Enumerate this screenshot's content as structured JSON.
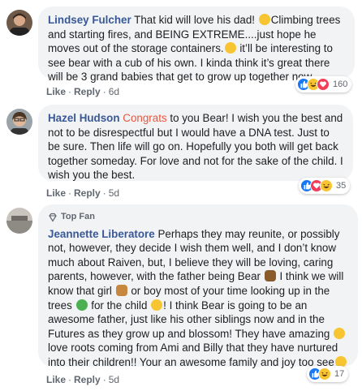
{
  "comments": [
    {
      "author": "Lindsey Fulcher",
      "text_parts": [
        " That kid will love his dad! ",
        "Climbing trees and starting fires, and BEING EXTREME....just hope he moves out of the storage containers.",
        " it’ll be interesting to see bear with a cub of his own. I kinda think it’s great there will be 3 grand babies that get to grow up together now."
      ],
      "actions": {
        "like": "Like",
        "reply": "Reply",
        "time": "6d"
      },
      "reaction_count": "160",
      "reaction_icons": [
        "like-icon",
        "haha-icon",
        "love-icon"
      ]
    },
    {
      "author": "Hazel Hudson",
      "highlight": "Congrats",
      "text": " to you Bear! I wish you the best and not to be disrespectful but I would have a DNA test. Just to be sure. Then life will go on. Hopefully you both will get back together someday. For love and not for the sake of the child. I wish you the best.",
      "actions": {
        "like": "Like",
        "reply": "Reply",
        "time": "5d"
      },
      "reaction_count": "35",
      "reaction_icons": [
        "like-icon",
        "love-icon",
        "haha-icon"
      ]
    },
    {
      "badge": "Top Fan",
      "author": "Jeannette Liberatore",
      "text_parts": [
        " Perhaps they may reunite, or possibly not, however, they decide I wish them well, and I don’t know much about Raiven, but, I believe they will be loving, caring parents, however, with the father being Bear ",
        " I think we will know that girl ",
        " or boy most of your time looking up in the trees ",
        " for the child ",
        "! I think Bear is going to be an awesome father, just like his other siblings now and in the Futures as they grow up and blossom! They have amazing ",
        " love roots coming from Ami and Billy that they have nurtured into their children!! Your an awesome family and joy too see"
      ],
      "actions": {
        "like": "Like",
        "reply": "Reply",
        "time": "5d"
      },
      "reaction_count": "17",
      "reaction_icons": [
        "like-icon",
        "haha-icon"
      ]
    }
  ],
  "colors": {
    "author": "#385898",
    "bubble": "#f2f3f5",
    "highlight": "#e9573f",
    "meta": "#606770"
  }
}
